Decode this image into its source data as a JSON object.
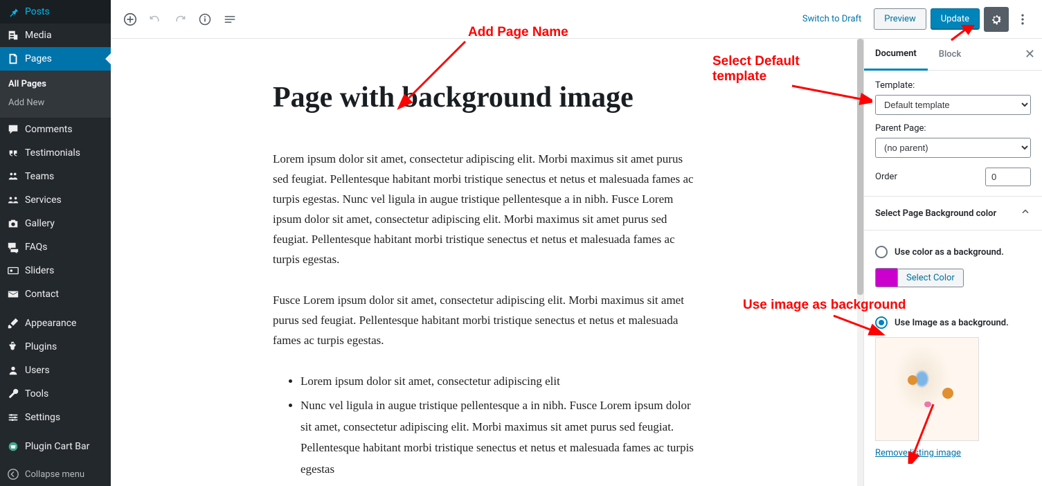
{
  "sidebar": {
    "items": [
      {
        "id": "posts",
        "label": "Posts",
        "icon": "pin"
      },
      {
        "id": "media",
        "label": "Media",
        "icon": "media"
      },
      {
        "id": "pages",
        "label": "Pages",
        "icon": "page",
        "current": true,
        "submenu": [
          {
            "label": "All Pages",
            "current": true
          },
          {
            "label": "Add New"
          }
        ]
      },
      {
        "id": "comments",
        "label": "Comments",
        "icon": "comment"
      },
      {
        "id": "testimonials",
        "label": "Testimonials",
        "icon": "quote"
      },
      {
        "id": "teams",
        "label": "Teams",
        "icon": "group"
      },
      {
        "id": "services",
        "label": "Services",
        "icon": "group2"
      },
      {
        "id": "gallery",
        "label": "Gallery",
        "icon": "camera"
      },
      {
        "id": "faqs",
        "label": "FAQs",
        "icon": "chat"
      },
      {
        "id": "sliders",
        "label": "Sliders",
        "icon": "slider"
      },
      {
        "id": "contact",
        "label": "Contact",
        "icon": "mail"
      },
      {
        "separator": true
      },
      {
        "id": "appearance",
        "label": "Appearance",
        "icon": "brush"
      },
      {
        "id": "plugins",
        "label": "Plugins",
        "icon": "plug"
      },
      {
        "id": "users",
        "label": "Users",
        "icon": "user"
      },
      {
        "id": "tools",
        "label": "Tools",
        "icon": "wrench"
      },
      {
        "id": "settings",
        "label": "Settings",
        "icon": "sliders"
      },
      {
        "separator": true
      },
      {
        "id": "plugin-cart-bar",
        "label": "Plugin Cart Bar",
        "icon": "cart"
      }
    ],
    "collapse_label": "Collapse menu"
  },
  "header": {
    "switch_to_draft": "Switch to Draft",
    "preview": "Preview",
    "update": "Update"
  },
  "content": {
    "title": "Page with background image",
    "para1": "Lorem ipsum dolor sit amet, consectetur adipiscing elit. Morbi maximus sit amet purus sed feugiat. Pellentesque habitant morbi tristique senectus et netus et malesuada fames ac turpis egestas. Nunc vel ligula in augue tristique pellentesque a in nibh. Fusce Lorem ipsum dolor sit amet, consectetur adipiscing elit. Morbi maximus sit amet purus sed feugiat. Pellentesque habitant morbi tristique senectus et netus et malesuada fames ac turpis egestas.",
    "para2": "Fusce Lorem ipsum dolor sit amet, consectetur adipiscing elit. Morbi maximus sit amet purus sed feugiat. Pellentesque habitant morbi tristique senectus et netus et malesuada fames ac turpis egestas.",
    "bullets": [
      "Lorem ipsum dolor sit amet, consectetur adipiscing elit",
      "Nunc vel ligula in augue tristique pellentesque a in nibh. Fusce Lorem ipsum dolor sit amet, consectetur adipiscing elit. Morbi maximus sit amet purus sed feugiat. Pellentesque habitant morbi tristique senectus et netus et malesuada fames ac turpis egestas"
    ]
  },
  "inspector": {
    "tabs": {
      "document": "Document",
      "block": "Block"
    },
    "template_label": "Template:",
    "template_value": "Default template",
    "parent_label": "Parent Page:",
    "parent_value": "(no parent)",
    "order_label": "Order",
    "order_value": "0",
    "bg_panel_title": "Select Page Background color",
    "radio_color_label": "Use color as a background.",
    "radio_image_label": "Use Image as a background.",
    "select_color_btn": "Select Color",
    "color_swatch": "#cc00cc",
    "remove_image_label": "Remove listing image"
  },
  "annotations": {
    "add_page_name": "Add Page Name",
    "select_default_template": "Select Default template",
    "use_image_bg": "Use image as background"
  }
}
